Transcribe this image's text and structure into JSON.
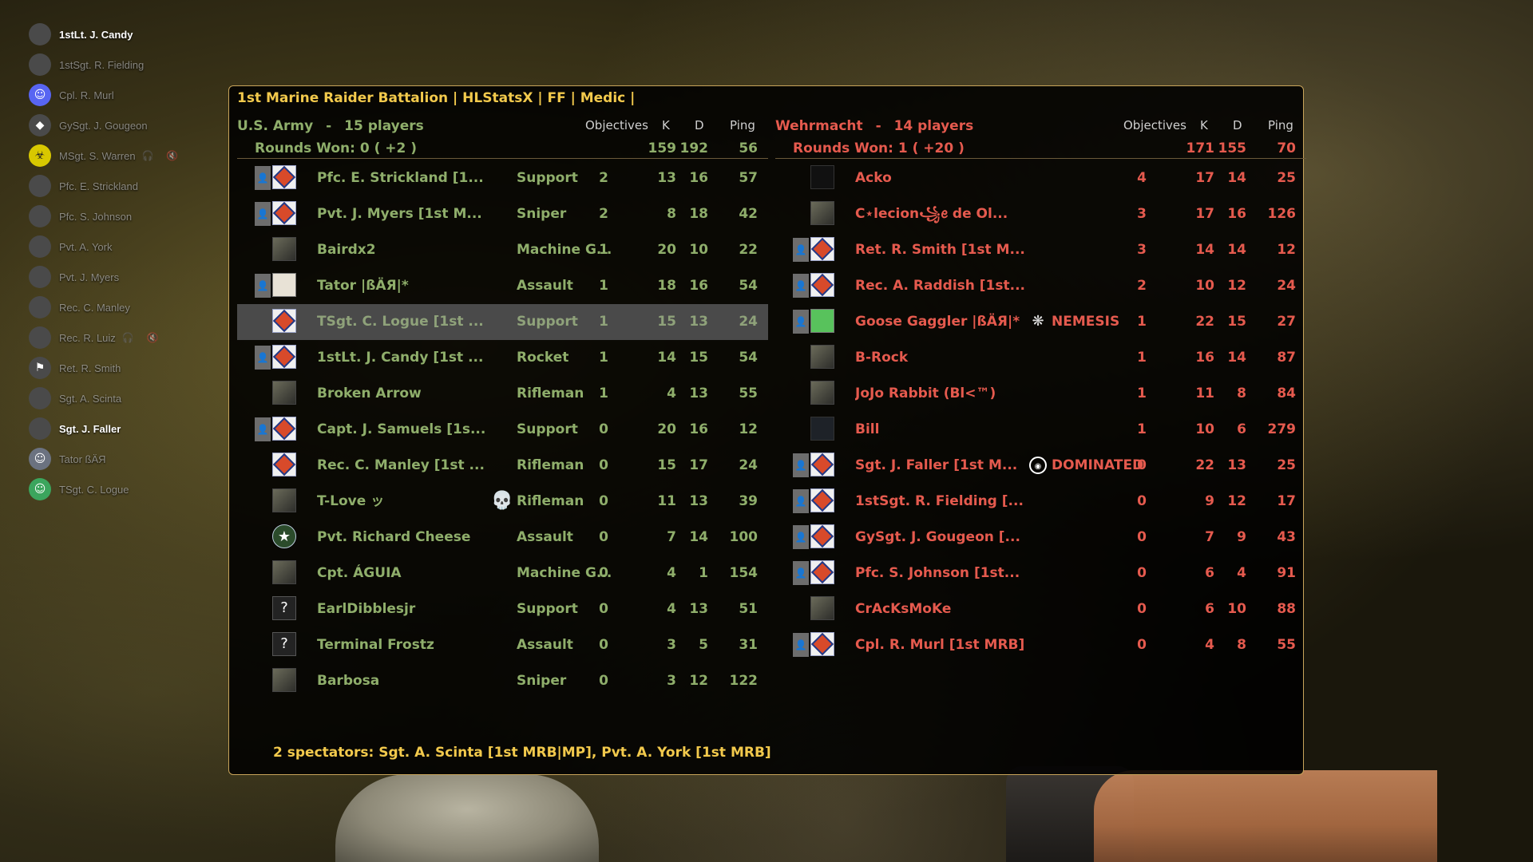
{
  "voice_list": [
    {
      "name": "1stLt. J. Candy",
      "avatar": "portrait",
      "active": true,
      "flags": ""
    },
    {
      "name": "1stSgt. R. Fielding",
      "avatar": "portrait",
      "active": false,
      "flags": ""
    },
    {
      "name": "Cpl. R. Murl",
      "avatar": "discord",
      "active": false,
      "flags": ""
    },
    {
      "name": "GySgt. J. Gougeon",
      "avatar": "emblem",
      "active": false,
      "flags": ""
    },
    {
      "name": "MSgt. S. Warren",
      "avatar": "biohazard",
      "active": false,
      "flags": "🎧 🔇"
    },
    {
      "name": "Pfc. E. Strickland",
      "avatar": "portrait",
      "active": false,
      "flags": ""
    },
    {
      "name": "Pfc. S. Johnson",
      "avatar": "portrait",
      "active": false,
      "flags": ""
    },
    {
      "name": "Pvt. A. York",
      "avatar": "portrait",
      "active": false,
      "flags": ""
    },
    {
      "name": "Pvt. J. Myers",
      "avatar": "portrait",
      "active": false,
      "flags": ""
    },
    {
      "name": "Rec. C. Manley",
      "avatar": "portrait",
      "active": false,
      "flags": ""
    },
    {
      "name": "Rec. R. Luiz",
      "avatar": "portrait",
      "active": false,
      "flags": "🎧 🔇"
    },
    {
      "name": "Ret. R. Smith",
      "avatar": "flag",
      "active": false,
      "flags": ""
    },
    {
      "name": "Sgt. A. Scinta",
      "avatar": "portrait",
      "active": false,
      "flags": ""
    },
    {
      "name": "Sgt. J. Faller",
      "avatar": "portrait",
      "active": true,
      "flags": ""
    },
    {
      "name": "Tator ßÄЯ",
      "avatar": "discord-gray",
      "active": false,
      "flags": ""
    },
    {
      "name": "TSgt. C. Logue",
      "avatar": "discord-green",
      "active": false,
      "flags": ""
    }
  ],
  "scoreboard": {
    "server_title": "1st Marine Raider Battalion | HLStatsX | FF | Medic |",
    "headers": {
      "objectives": "Objectives",
      "k": "K",
      "d": "D",
      "ping": "Ping"
    },
    "allies": {
      "name": "U.S. Army",
      "separator": "-",
      "players_count": "15 players",
      "rounds_won": "Rounds Won: 0 ( +2 )",
      "totals": {
        "k": "159",
        "d": "192",
        "ping": "56"
      },
      "color": "#8fae6b",
      "players": [
        {
          "name": "Pfc. E. Strickland [1...",
          "cls": "Support",
          "obj": "2",
          "k": "13",
          "d": "16",
          "ping": "57",
          "ribbon": true,
          "emblem": "mrb",
          "status": "",
          "highlight": false
        },
        {
          "name": "Pvt. J. Myers [1st M...",
          "cls": "Sniper",
          "obj": "2",
          "k": "8",
          "d": "18",
          "ping": "42",
          "ribbon": true,
          "emblem": "mrb",
          "status": "",
          "highlight": false
        },
        {
          "name": "Bairdx2",
          "cls": "Machine G...",
          "obj": "1",
          "k": "20",
          "d": "10",
          "ping": "22",
          "ribbon": false,
          "emblem": "photo",
          "status": "",
          "highlight": false
        },
        {
          "name": "Tator |ßÄЯ|*",
          "cls": "Assault",
          "obj": "1",
          "k": "18",
          "d": "16",
          "ping": "54",
          "ribbon": true,
          "emblem": "clown",
          "status": "",
          "highlight": false
        },
        {
          "name": "TSgt. C. Logue [1st ...",
          "cls": "Support",
          "obj": "1",
          "k": "15",
          "d": "13",
          "ping": "24",
          "ribbon": false,
          "emblem": "mrb",
          "status": "",
          "highlight": true
        },
        {
          "name": "1stLt. J. Candy [1st ...",
          "cls": "Rocket",
          "obj": "1",
          "k": "14",
          "d": "15",
          "ping": "54",
          "ribbon": true,
          "emblem": "mrb",
          "status": "",
          "highlight": false
        },
        {
          "name": "Broken Arrow",
          "cls": "Rifleman",
          "obj": "1",
          "k": "4",
          "d": "13",
          "ping": "55",
          "ribbon": false,
          "emblem": "photo",
          "status": "",
          "highlight": false
        },
        {
          "name": "Capt. J. Samuels [1s...",
          "cls": "Support",
          "obj": "0",
          "k": "20",
          "d": "16",
          "ping": "12",
          "ribbon": true,
          "emblem": "mrb",
          "status": "",
          "highlight": false
        },
        {
          "name": "Rec. C. Manley [1st ...",
          "cls": "Rifleman",
          "obj": "0",
          "k": "15",
          "d": "17",
          "ping": "24",
          "ribbon": false,
          "emblem": "mrb",
          "status": "",
          "highlight": false
        },
        {
          "name": "T-Love ッ",
          "cls": "Rifleman",
          "obj": "0",
          "k": "11",
          "d": "13",
          "ping": "39",
          "ribbon": false,
          "emblem": "photo",
          "status": "skull",
          "highlight": false
        },
        {
          "name": "Pvt. Richard Cheese",
          "cls": "Assault",
          "obj": "0",
          "k": "7",
          "d": "14",
          "ping": "100",
          "ribbon": false,
          "emblem": "star",
          "status": "",
          "highlight": false
        },
        {
          "name": "Cpt. ÁGUIA",
          "cls": "Machine G...",
          "obj": "0",
          "k": "4",
          "d": "1",
          "ping": "154",
          "ribbon": false,
          "emblem": "photo",
          "status": "",
          "highlight": false
        },
        {
          "name": "EarlDibblesjr",
          "cls": "Support",
          "obj": "0",
          "k": "4",
          "d": "13",
          "ping": "51",
          "ribbon": false,
          "emblem": "q",
          "status": "",
          "highlight": false
        },
        {
          "name": "Terminal Frostz",
          "cls": "Assault",
          "obj": "0",
          "k": "3",
          "d": "5",
          "ping": "31",
          "ribbon": false,
          "emblem": "q",
          "status": "",
          "highlight": false
        },
        {
          "name": "Barbosa",
          "cls": "Sniper",
          "obj": "0",
          "k": "3",
          "d": "12",
          "ping": "122",
          "ribbon": false,
          "emblem": "photo",
          "status": "",
          "highlight": false
        }
      ]
    },
    "axis": {
      "name": "Wehrmacht",
      "separator": "-",
      "players_count": "14 players",
      "rounds_won": "Rounds Won: 1 ( +20 )",
      "totals": {
        "k": "171",
        "d": "155",
        "ping": "70"
      },
      "color": "#e55a4e",
      "players": [
        {
          "name": "Acko",
          "obj": "4",
          "k": "17",
          "d": "14",
          "ping": "25",
          "ribbon": false,
          "emblem": "acko",
          "status": "",
          "status_label": ""
        },
        {
          "name": "C⋆lecion꧁ꫀ de Ol...",
          "obj": "3",
          "k": "17",
          "d": "16",
          "ping": "126",
          "ribbon": false,
          "emblem": "photo",
          "status": "",
          "status_label": ""
        },
        {
          "name": "Ret. R. Smith [1st M...",
          "obj": "3",
          "k": "14",
          "d": "14",
          "ping": "12",
          "ribbon": true,
          "emblem": "mrb",
          "status": "",
          "status_label": ""
        },
        {
          "name": "Rec. A. Raddish [1st...",
          "obj": "2",
          "k": "10",
          "d": "12",
          "ping": "24",
          "ribbon": true,
          "emblem": "mrb",
          "status": "",
          "status_label": ""
        },
        {
          "name": "Goose Gaggler |ßÄЯ|*",
          "obj": "1",
          "k": "22",
          "d": "15",
          "ping": "27",
          "ribbon": true,
          "emblem": "goose",
          "status": "nemesis",
          "status_label": "NEMESIS"
        },
        {
          "name": "B-Rock",
          "obj": "1",
          "k": "16",
          "d": "14",
          "ping": "87",
          "ribbon": false,
          "emblem": "photo",
          "status": "",
          "status_label": ""
        },
        {
          "name": "JoJo Rabbit (Bl<™)",
          "obj": "1",
          "k": "11",
          "d": "8",
          "ping": "84",
          "ribbon": false,
          "emblem": "photo",
          "status": "",
          "status_label": ""
        },
        {
          "name": "Bill",
          "obj": "1",
          "k": "10",
          "d": "6",
          "ping": "279",
          "ribbon": false,
          "emblem": "dark",
          "status": "",
          "status_label": ""
        },
        {
          "name": "Sgt. J. Faller [1st M...",
          "obj": "0",
          "k": "22",
          "d": "13",
          "ping": "25",
          "ribbon": true,
          "emblem": "mrb",
          "status": "dominated",
          "status_label": "DOMINATED"
        },
        {
          "name": "1stSgt. R. Fielding [...",
          "obj": "0",
          "k": "9",
          "d": "12",
          "ping": "17",
          "ribbon": true,
          "emblem": "mrb",
          "status": "",
          "status_label": ""
        },
        {
          "name": "GySgt. J. Gougeon [...",
          "obj": "0",
          "k": "7",
          "d": "9",
          "ping": "43",
          "ribbon": true,
          "emblem": "mrb",
          "status": "",
          "status_label": ""
        },
        {
          "name": "Pfc. S. Johnson [1st...",
          "obj": "0",
          "k": "6",
          "d": "4",
          "ping": "91",
          "ribbon": true,
          "emblem": "mrb",
          "status": "",
          "status_label": ""
        },
        {
          "name": "CrAcKsMoKe",
          "obj": "0",
          "k": "6",
          "d": "10",
          "ping": "88",
          "ribbon": false,
          "emblem": "photo",
          "status": "",
          "status_label": ""
        },
        {
          "name": "Cpl. R. Murl [1st MRB]",
          "obj": "0",
          "k": "4",
          "d": "8",
          "ping": "55",
          "ribbon": true,
          "emblem": "mrb",
          "status": "",
          "status_label": ""
        }
      ]
    },
    "spectators": "2 spectators: Sgt. A. Scinta [1st MRB|MP], Pvt. A. York [1st MRB]"
  }
}
